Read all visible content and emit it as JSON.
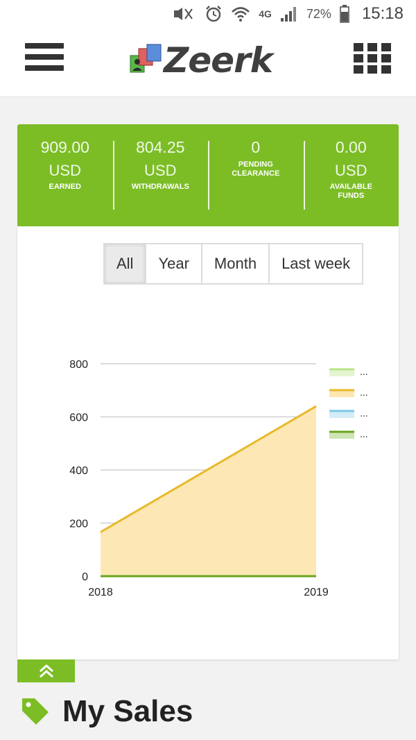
{
  "status_bar": {
    "battery_pct": "72%",
    "time": "15:18",
    "network": "4G"
  },
  "header": {
    "logo_text": "Zeerk"
  },
  "stats": [
    {
      "amount": "909.00",
      "currency": "USD",
      "label": "EARNED"
    },
    {
      "amount": "804.25",
      "currency": "USD",
      "label": "WITHDRAWALS"
    },
    {
      "amount": "0",
      "currency": "",
      "label": "PENDING CLEARANCE"
    },
    {
      "amount": "0.00",
      "currency": "USD",
      "label": "AVAILABLE FUNDS"
    }
  ],
  "filters": [
    "All",
    "Year",
    "Month",
    "Last week"
  ],
  "active_filter": "All",
  "chart_data": {
    "type": "area",
    "x": [
      "2018",
      "2019"
    ],
    "ylim": [
      0,
      800
    ],
    "yticks": [
      0,
      200,
      400,
      600,
      800
    ],
    "grid": true,
    "legend": "right",
    "series": [
      {
        "label": "...",
        "values": [
          0,
          0
        ],
        "color": "#b8e58a"
      },
      {
        "label": "...",
        "values": [
          166,
          640
        ],
        "color": "#e8b92a"
      },
      {
        "label": "...",
        "values": [
          0,
          0
        ],
        "color": "#7ec7e8"
      },
      {
        "label": "...",
        "values": [
          0,
          0
        ],
        "color": "#6aa51f"
      }
    ]
  },
  "section_title": "My Sales",
  "colors": {
    "brand_green": "#7cbd26"
  }
}
